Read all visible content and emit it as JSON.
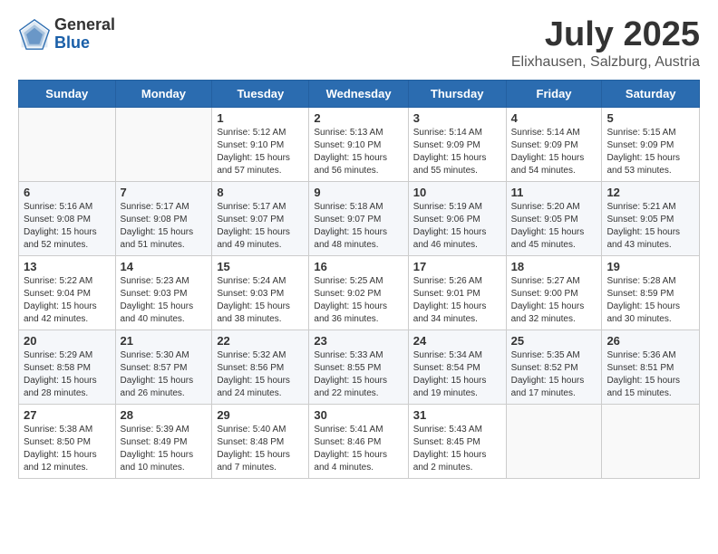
{
  "header": {
    "logo_general": "General",
    "logo_blue": "Blue",
    "month": "July 2025",
    "location": "Elixhausen, Salzburg, Austria"
  },
  "days_of_week": [
    "Sunday",
    "Monday",
    "Tuesday",
    "Wednesday",
    "Thursday",
    "Friday",
    "Saturday"
  ],
  "weeks": [
    [
      {
        "day": "",
        "sunrise": "",
        "sunset": "",
        "daylight": ""
      },
      {
        "day": "",
        "sunrise": "",
        "sunset": "",
        "daylight": ""
      },
      {
        "day": "1",
        "sunrise": "Sunrise: 5:12 AM",
        "sunset": "Sunset: 9:10 PM",
        "daylight": "Daylight: 15 hours and 57 minutes."
      },
      {
        "day": "2",
        "sunrise": "Sunrise: 5:13 AM",
        "sunset": "Sunset: 9:10 PM",
        "daylight": "Daylight: 15 hours and 56 minutes."
      },
      {
        "day": "3",
        "sunrise": "Sunrise: 5:14 AM",
        "sunset": "Sunset: 9:09 PM",
        "daylight": "Daylight: 15 hours and 55 minutes."
      },
      {
        "day": "4",
        "sunrise": "Sunrise: 5:14 AM",
        "sunset": "Sunset: 9:09 PM",
        "daylight": "Daylight: 15 hours and 54 minutes."
      },
      {
        "day": "5",
        "sunrise": "Sunrise: 5:15 AM",
        "sunset": "Sunset: 9:09 PM",
        "daylight": "Daylight: 15 hours and 53 minutes."
      }
    ],
    [
      {
        "day": "6",
        "sunrise": "Sunrise: 5:16 AM",
        "sunset": "Sunset: 9:08 PM",
        "daylight": "Daylight: 15 hours and 52 minutes."
      },
      {
        "day": "7",
        "sunrise": "Sunrise: 5:17 AM",
        "sunset": "Sunset: 9:08 PM",
        "daylight": "Daylight: 15 hours and 51 minutes."
      },
      {
        "day": "8",
        "sunrise": "Sunrise: 5:17 AM",
        "sunset": "Sunset: 9:07 PM",
        "daylight": "Daylight: 15 hours and 49 minutes."
      },
      {
        "day": "9",
        "sunrise": "Sunrise: 5:18 AM",
        "sunset": "Sunset: 9:07 PM",
        "daylight": "Daylight: 15 hours and 48 minutes."
      },
      {
        "day": "10",
        "sunrise": "Sunrise: 5:19 AM",
        "sunset": "Sunset: 9:06 PM",
        "daylight": "Daylight: 15 hours and 46 minutes."
      },
      {
        "day": "11",
        "sunrise": "Sunrise: 5:20 AM",
        "sunset": "Sunset: 9:05 PM",
        "daylight": "Daylight: 15 hours and 45 minutes."
      },
      {
        "day": "12",
        "sunrise": "Sunrise: 5:21 AM",
        "sunset": "Sunset: 9:05 PM",
        "daylight": "Daylight: 15 hours and 43 minutes."
      }
    ],
    [
      {
        "day": "13",
        "sunrise": "Sunrise: 5:22 AM",
        "sunset": "Sunset: 9:04 PM",
        "daylight": "Daylight: 15 hours and 42 minutes."
      },
      {
        "day": "14",
        "sunrise": "Sunrise: 5:23 AM",
        "sunset": "Sunset: 9:03 PM",
        "daylight": "Daylight: 15 hours and 40 minutes."
      },
      {
        "day": "15",
        "sunrise": "Sunrise: 5:24 AM",
        "sunset": "Sunset: 9:03 PM",
        "daylight": "Daylight: 15 hours and 38 minutes."
      },
      {
        "day": "16",
        "sunrise": "Sunrise: 5:25 AM",
        "sunset": "Sunset: 9:02 PM",
        "daylight": "Daylight: 15 hours and 36 minutes."
      },
      {
        "day": "17",
        "sunrise": "Sunrise: 5:26 AM",
        "sunset": "Sunset: 9:01 PM",
        "daylight": "Daylight: 15 hours and 34 minutes."
      },
      {
        "day": "18",
        "sunrise": "Sunrise: 5:27 AM",
        "sunset": "Sunset: 9:00 PM",
        "daylight": "Daylight: 15 hours and 32 minutes."
      },
      {
        "day": "19",
        "sunrise": "Sunrise: 5:28 AM",
        "sunset": "Sunset: 8:59 PM",
        "daylight": "Daylight: 15 hours and 30 minutes."
      }
    ],
    [
      {
        "day": "20",
        "sunrise": "Sunrise: 5:29 AM",
        "sunset": "Sunset: 8:58 PM",
        "daylight": "Daylight: 15 hours and 28 minutes."
      },
      {
        "day": "21",
        "sunrise": "Sunrise: 5:30 AM",
        "sunset": "Sunset: 8:57 PM",
        "daylight": "Daylight: 15 hours and 26 minutes."
      },
      {
        "day": "22",
        "sunrise": "Sunrise: 5:32 AM",
        "sunset": "Sunset: 8:56 PM",
        "daylight": "Daylight: 15 hours and 24 minutes."
      },
      {
        "day": "23",
        "sunrise": "Sunrise: 5:33 AM",
        "sunset": "Sunset: 8:55 PM",
        "daylight": "Daylight: 15 hours and 22 minutes."
      },
      {
        "day": "24",
        "sunrise": "Sunrise: 5:34 AM",
        "sunset": "Sunset: 8:54 PM",
        "daylight": "Daylight: 15 hours and 19 minutes."
      },
      {
        "day": "25",
        "sunrise": "Sunrise: 5:35 AM",
        "sunset": "Sunset: 8:52 PM",
        "daylight": "Daylight: 15 hours and 17 minutes."
      },
      {
        "day": "26",
        "sunrise": "Sunrise: 5:36 AM",
        "sunset": "Sunset: 8:51 PM",
        "daylight": "Daylight: 15 hours and 15 minutes."
      }
    ],
    [
      {
        "day": "27",
        "sunrise": "Sunrise: 5:38 AM",
        "sunset": "Sunset: 8:50 PM",
        "daylight": "Daylight: 15 hours and 12 minutes."
      },
      {
        "day": "28",
        "sunrise": "Sunrise: 5:39 AM",
        "sunset": "Sunset: 8:49 PM",
        "daylight": "Daylight: 15 hours and 10 minutes."
      },
      {
        "day": "29",
        "sunrise": "Sunrise: 5:40 AM",
        "sunset": "Sunset: 8:48 PM",
        "daylight": "Daylight: 15 hours and 7 minutes."
      },
      {
        "day": "30",
        "sunrise": "Sunrise: 5:41 AM",
        "sunset": "Sunset: 8:46 PM",
        "daylight": "Daylight: 15 hours and 4 minutes."
      },
      {
        "day": "31",
        "sunrise": "Sunrise: 5:43 AM",
        "sunset": "Sunset: 8:45 PM",
        "daylight": "Daylight: 15 hours and 2 minutes."
      },
      {
        "day": "",
        "sunrise": "",
        "sunset": "",
        "daylight": ""
      },
      {
        "day": "",
        "sunrise": "",
        "sunset": "",
        "daylight": ""
      }
    ]
  ]
}
